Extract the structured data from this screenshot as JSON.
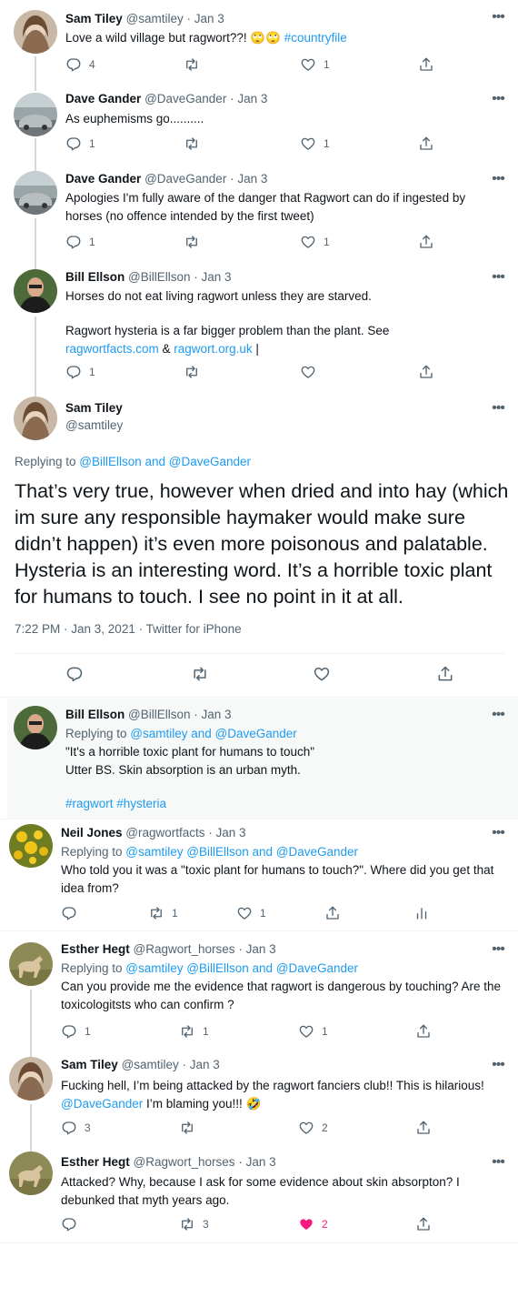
{
  "tweets": [
    {
      "name": "Sam Tiley",
      "handle": "@samtiley",
      "date": "· Jan 3",
      "text": "Love a wild village but ragwort??! 🙄🙄 ",
      "hashtag": "#countryfile",
      "replies": "4",
      "retweets": "",
      "likes": "1"
    },
    {
      "name": "Dave Gander",
      "handle": "@DaveGander",
      "date": "· Jan 3",
      "text": "As euphemisms go..........",
      "replies": "1",
      "retweets": "",
      "likes": "1"
    },
    {
      "name": "Dave Gander",
      "handle": "@DaveGander",
      "date": "· Jan 3",
      "text": "Apologies I'm fully aware of the danger that Ragwort can do if ingested by horses (no offence intended by the first tweet)",
      "replies": "1",
      "retweets": "",
      "likes": "1"
    },
    {
      "name": "Bill Ellson",
      "handle": "@BillEllson",
      "date": "· Jan 3",
      "text": "Horses do not eat living ragwort unless they are starved.",
      "text2": "Ragwort hysteria is a far bigger problem than the plant. See",
      "link1": "ragwortfacts.com",
      "sep": " & ",
      "link2": "ragwort.org.uk",
      "tail": " |",
      "replies": "1",
      "retweets": "",
      "likes": ""
    }
  ],
  "main_tweet": {
    "name": "Sam Tiley",
    "handle": "@samtiley",
    "replying_label": "Replying to ",
    "replying_to": "@BillEllson and @DaveGander",
    "text": "That’s very true, however when dried and into hay (which im sure any responsible haymaker would make sure didn’t happen) it’s even more poisonous and palatable. Hysteria is an interesting word. It’s a horrible toxic plant for humans to touch. I see no point in it at all.",
    "timestamp": "7:22 PM · Jan 3, 2021 · Twitter for iPhone"
  },
  "replies": [
    {
      "name": "Bill Ellson",
      "handle": "@BillEllson",
      "date": "· Jan 3",
      "replying_label": "Replying to ",
      "replying_to": "@samtiley and @DaveGander",
      "line1": "\"It's a horrible toxic plant for humans to touch\"",
      "line2": "Utter BS. Skin absorption is an urban myth.",
      "hashtags": "#ragwort #hysteria"
    },
    {
      "name": "Neil Jones",
      "handle": "@ragwortfacts",
      "date": "· Jan 3",
      "replying_label": "Replying to ",
      "replying_to": "@samtiley @BillEllson and @DaveGander",
      "text": "Who told you it was  a \"toxic plant for humans to touch?\". Where did you get that idea from?",
      "replies": "",
      "retweets": "1",
      "likes": "1"
    },
    {
      "name": "Esther Hegt",
      "handle": "@Ragwort_horses",
      "date": "· Jan 3",
      "replying_label": "Replying to ",
      "replying_to": "@samtiley @BillEllson and @DaveGander",
      "text": "Can you provide me the evidence that ragwort is dangerous by touching? Are the toxicologitsts who can confirm ?",
      "replies": "1",
      "retweets": "1",
      "likes": "1"
    },
    {
      "name": "Sam Tiley",
      "handle": "@samtiley",
      "date": "· Jan 3",
      "text": "Fucking hell, I’m being attacked by the ragwort fanciers club!! This is hilarious! ",
      "mention": "@DaveGander",
      "tail": " I’m blaming you!!! 🤣",
      "replies": "3",
      "retweets": "",
      "likes": "2"
    },
    {
      "name": "Esther Hegt",
      "handle": "@Ragwort_horses",
      "date": "· Jan 3",
      "text": "Attacked? Why, because I ask for some evidence about skin absorpton?  I debunked that myth years ago.",
      "replies": "",
      "retweets": "3",
      "likes": "2"
    }
  ],
  "colors": {
    "link": "#1d9bf0",
    "muted": "#536471",
    "liked": "#f91880"
  },
  "icons": [
    "reply-icon",
    "retweet-icon",
    "like-icon",
    "share-icon",
    "analytics-icon",
    "more-icon"
  ]
}
